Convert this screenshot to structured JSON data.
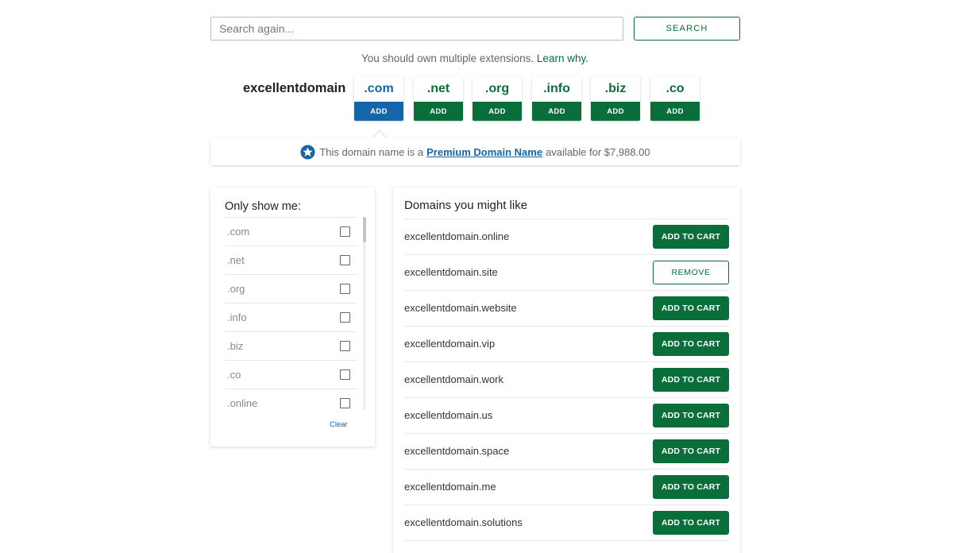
{
  "search": {
    "placeholder": "Search again...",
    "button_label": "SEARCH"
  },
  "tagline": {
    "text": "You should own multiple extensions.",
    "link_label": "Learn why."
  },
  "domain": {
    "name": "excellentdomain"
  },
  "extensions": [
    {
      "label": ".com",
      "button": "ADD",
      "selected": true
    },
    {
      "label": ".net",
      "button": "ADD",
      "selected": false
    },
    {
      "label": ".org",
      "button": "ADD",
      "selected": false
    },
    {
      "label": ".info",
      "button": "ADD",
      "selected": false
    },
    {
      "label": ".biz",
      "button": "ADD",
      "selected": false
    },
    {
      "label": ".co",
      "button": "ADD",
      "selected": false
    }
  ],
  "premium": {
    "icon": "star-badge-icon",
    "text_before": "This domain name is a",
    "link_label": "Premium Domain Name",
    "text_after": "available for $7,988.00"
  },
  "filters": {
    "title": "Only show me:",
    "items": [
      {
        "label": ".com",
        "checked": false
      },
      {
        "label": ".net",
        "checked": false
      },
      {
        "label": ".org",
        "checked": false
      },
      {
        "label": ".info",
        "checked": false
      },
      {
        "label": ".biz",
        "checked": false
      },
      {
        "label": ".co",
        "checked": false
      },
      {
        "label": ".online",
        "checked": false
      }
    ],
    "clear_label": "Clear"
  },
  "suggestions": {
    "title": "Domains you might like",
    "items": [
      {
        "domain": "excellentdomain.online",
        "action": "ADD TO CART",
        "in_cart": false
      },
      {
        "domain": "excellentdomain.site",
        "action": "REMOVE",
        "in_cart": true
      },
      {
        "domain": "excellentdomain.website",
        "action": "ADD TO CART",
        "in_cart": false
      },
      {
        "domain": "excellentdomain.vip",
        "action": "ADD TO CART",
        "in_cart": false
      },
      {
        "domain": "excellentdomain.work",
        "action": "ADD TO CART",
        "in_cart": false
      },
      {
        "domain": "excellentdomain.us",
        "action": "ADD TO CART",
        "in_cart": false
      },
      {
        "domain": "excellentdomain.space",
        "action": "ADD TO CART",
        "in_cart": false
      },
      {
        "domain": "excellentdomain.me",
        "action": "ADD TO CART",
        "in_cart": false
      },
      {
        "domain": "excellentdomain.solutions",
        "action": "ADD TO CART",
        "in_cart": false
      }
    ]
  },
  "colors": {
    "primary_green": "#0a6e3a",
    "selected_blue": "#1565a8"
  }
}
